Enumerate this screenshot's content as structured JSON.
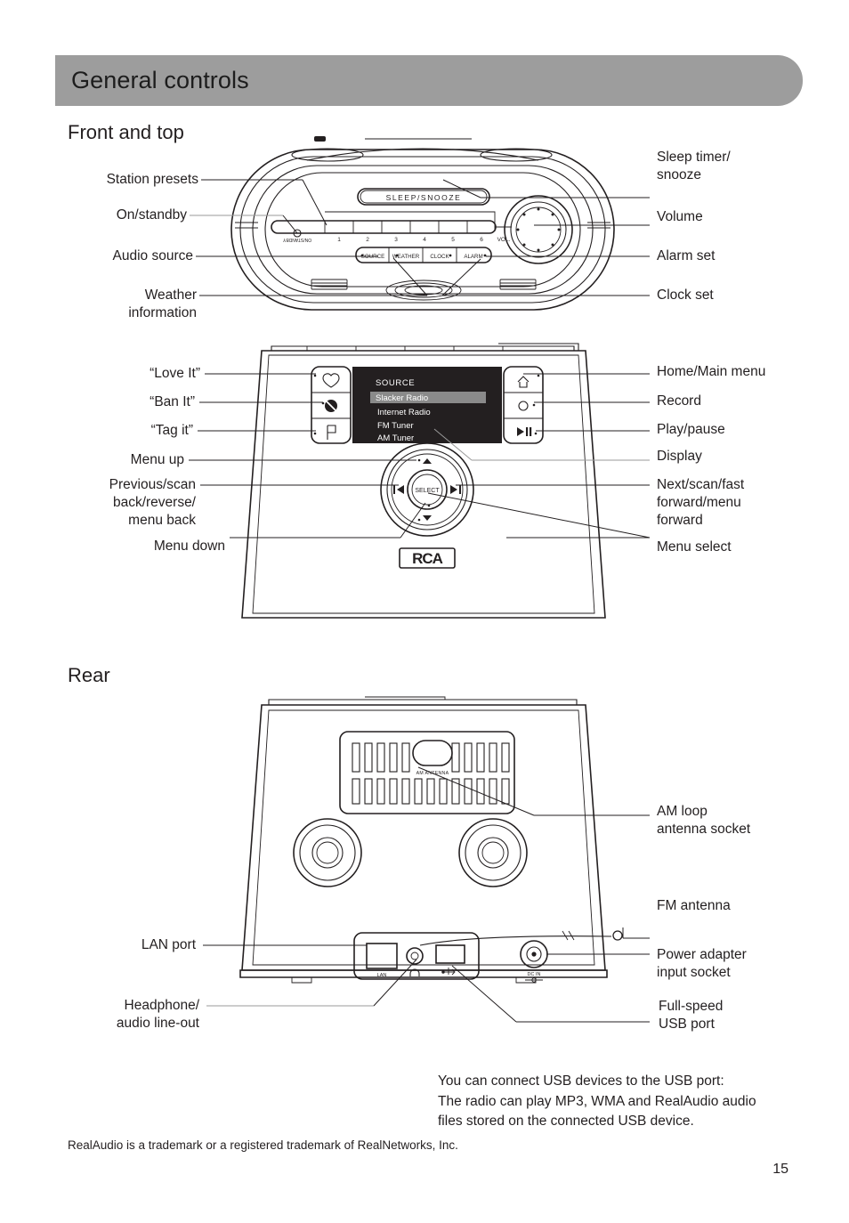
{
  "header": {
    "title": "General controls"
  },
  "sections": {
    "front": "Front and top",
    "rear": "Rear"
  },
  "top_view": {
    "labels_left": [
      {
        "text": "Station presets"
      },
      {
        "text": "On/standby"
      },
      {
        "text": "Audio source"
      },
      {
        "text": "Weather\ninformation"
      }
    ],
    "labels_right": [
      {
        "text": "Sleep timer/\nsnooze"
      },
      {
        "text": "Volume"
      },
      {
        "text": "Alarm set"
      },
      {
        "text": "Clock set"
      }
    ],
    "device_text": {
      "sleep_snooze": "SLEEP/SNOOZE",
      "on_standby": "ON/STANDBY",
      "volume_abbrev": "VOL.",
      "presets": [
        "1",
        "2",
        "3",
        "4",
        "5",
        "6"
      ],
      "buttons": [
        "SOURCE",
        "WEATHER",
        "CLOCK",
        "ALARM"
      ]
    }
  },
  "front_view": {
    "labels_left": [
      {
        "text": "“Love It”"
      },
      {
        "text": "“Ban It”"
      },
      {
        "text": "“Tag it”"
      },
      {
        "text": "Menu up"
      },
      {
        "text": "Previous/scan\nback/reverse/\nmenu back"
      },
      {
        "text": "Menu down"
      }
    ],
    "labels_right": [
      {
        "text": "Home/Main menu"
      },
      {
        "text": "Record"
      },
      {
        "text": "Play/pause"
      },
      {
        "text": "Display"
      },
      {
        "text": "Next/scan/fast\nforward/menu\nforward"
      },
      {
        "text": "Menu select"
      }
    ],
    "display": {
      "heading": "SOURCE",
      "items": [
        {
          "label": "Slacker Radio",
          "selected": true
        },
        {
          "label": "Internet Radio",
          "selected": false
        },
        {
          "label": "FM Tuner",
          "selected": false
        },
        {
          "label": "AM Tuner",
          "selected": false
        }
      ]
    },
    "device_text": {
      "select_button": "SELECT",
      "brand": "RCA"
    }
  },
  "rear_view": {
    "labels_left": [
      {
        "text": "LAN port"
      },
      {
        "text": "Headphone/\naudio line-out"
      }
    ],
    "labels_right": [
      {
        "text": "AM loop\nantenna socket"
      },
      {
        "text": "FM antenna"
      },
      {
        "text": "Power adapter\ninput socket"
      },
      {
        "text": "Full-speed\nUSB port"
      }
    ],
    "device_text": {
      "am_antenna": "AM ANTENNA",
      "lan": "LAN",
      "dc_in": "DC IN"
    }
  },
  "note": "You can connect USB devices to the USB port:\nThe radio can play MP3, WMA and RealAudio audio\nfiles stored on the connected USB device.",
  "footnote": "RealAudio is a trademark or a registered trademark of RealNetworks, Inc.",
  "page_number": "15",
  "colors": {
    "header_bar": "#9d9d9d",
    "ink": "#231f20",
    "screen_bg": "#231f20",
    "screen_highlight": "#8a8a8a",
    "leader_grey": "#9a9a9a"
  }
}
